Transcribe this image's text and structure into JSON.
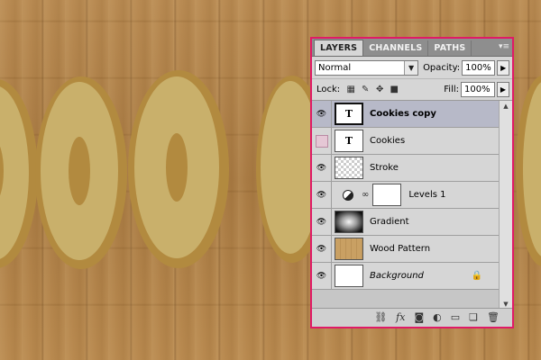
{
  "panel": {
    "tabs": [
      "LAYERS",
      "CHANNELS",
      "PATHS"
    ],
    "blend_mode": "Normal",
    "opacity_label": "Opacity:",
    "opacity_value": "100%",
    "lock_label": "Lock:",
    "fill_label": "Fill:",
    "fill_value": "100%",
    "accent_color": "#e01a66",
    "selected_color": "#b7b9c8"
  },
  "layers": [
    {
      "name": "Cookies copy",
      "thumb": "T",
      "type": "text",
      "visible": true,
      "selected": true
    },
    {
      "name": "Cookies",
      "thumb": "T",
      "type": "text",
      "visible": false,
      "selected": false
    },
    {
      "name": "Stroke",
      "thumb": "",
      "type": "transparent",
      "visible": true,
      "selected": false
    },
    {
      "name": "Levels 1",
      "thumb": "",
      "type": "adjustment",
      "visible": true,
      "selected": false
    },
    {
      "name": "Gradient",
      "thumb": "",
      "type": "gradient",
      "visible": true,
      "selected": false
    },
    {
      "name": "Wood Pattern",
      "thumb": "",
      "type": "wood",
      "visible": true,
      "selected": false
    },
    {
      "name": "Background",
      "thumb": "",
      "type": "background",
      "visible": true,
      "selected": false,
      "locked": true
    }
  ],
  "icons": {
    "eye": "👁",
    "lock": "🔒",
    "chain": "∞",
    "fx": "fx"
  }
}
